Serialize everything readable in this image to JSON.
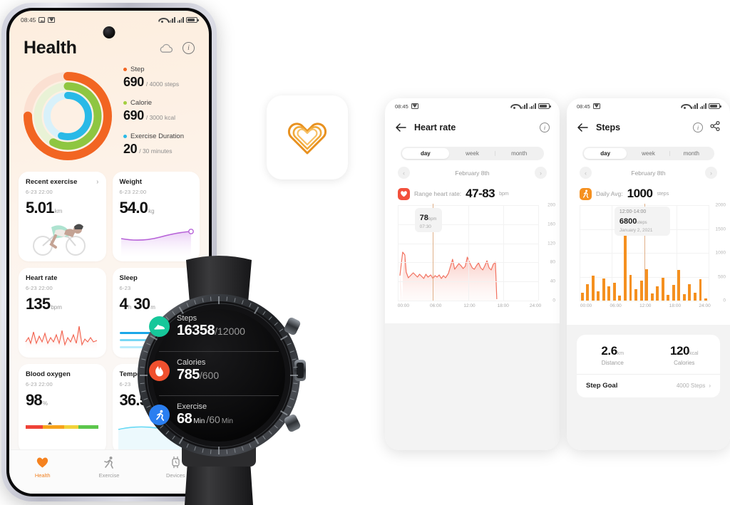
{
  "phone_health": {
    "status": {
      "time": "08:45",
      "icons": [
        "image-icon",
        "mail-icon",
        "wifi-icon",
        "signal-icon",
        "signal-icon",
        "battery-icon"
      ]
    },
    "header": {
      "title": "Health",
      "cloud_icon": "cloud-icon",
      "info_icon": "info-icon"
    },
    "rings": {
      "outer_color": "#f26522",
      "middle_color": "#8ec641",
      "inner_color": "#29b9e7",
      "outer_pct": 75,
      "middle_pct": 58,
      "inner_pct": 55
    },
    "metrics": [
      {
        "label": "Step",
        "value": "690",
        "goal": "/ 4000 steps",
        "color": "#f26522"
      },
      {
        "label": "Calorie",
        "value": "690",
        "goal": "/ 3000 kcal",
        "color": "#a3cf3f"
      },
      {
        "label": "Exercise Duration",
        "value": "20",
        "goal": "/ 30 minutes",
        "color": "#29b9e7"
      }
    ],
    "cards": [
      {
        "title": "Recent exercise",
        "date": "6-23  22:00",
        "value": "5.01",
        "unit": "km",
        "chevron": "›",
        "art": "cyclist-illustration"
      },
      {
        "title": "Weight",
        "date": "6-23  22:00",
        "value": "54.0",
        "unit": "kg",
        "chevron": "",
        "art": "weight-trend-line"
      },
      {
        "title": "Heart rate",
        "date": "6-23  22:00",
        "value": "135",
        "unit": "bpm",
        "chevron": "",
        "art": "heartrate-waveform"
      },
      {
        "title": "Sleep",
        "date": "6-23",
        "value": "4",
        "unit": "h",
        "value2": "30",
        "unit2": "m",
        "chevron": "",
        "art": "sleep-bars"
      },
      {
        "title": "Blood oxygen",
        "date": "6-23  22:00",
        "value": "98",
        "unit": "%",
        "chevron": "",
        "art": "spo2-gauge"
      },
      {
        "title": "Temperature",
        "date": "6-23",
        "value": "36.5",
        "unit": "",
        "chevron": "",
        "art": "temp-line"
      }
    ],
    "tabs": [
      {
        "label": "Health",
        "icon": "heart-icon",
        "active": true
      },
      {
        "label": "Exercise",
        "icon": "runner-icon",
        "active": false
      },
      {
        "label": "Devices",
        "icon": "watch-icon",
        "active": false
      }
    ]
  },
  "app_icon": {
    "name": "health-app-logo",
    "shape": "heart-outline-loop",
    "color": "#e8911f"
  },
  "phone_heartrate": {
    "status": {
      "time": "08:45"
    },
    "nav": {
      "back_icon": "back-arrow-icon",
      "title": "Heart rate",
      "info_icon": "info-icon"
    },
    "segments": [
      {
        "label": "day",
        "active": true
      },
      {
        "label": "week",
        "active": false
      },
      {
        "label": "month",
        "active": false
      }
    ],
    "date": {
      "label": "February 8th",
      "prev_icon": "chevron-left-icon",
      "next_icon": "chevron-right-icon"
    },
    "summary": {
      "icon": "heart-rate-icon",
      "icon_color": "#f2503c",
      "label": "Range heart rate:",
      "value": "47-83",
      "unit": "bpm"
    },
    "tooltip": {
      "value": "78",
      "unit": "bpm",
      "time": "07:30"
    },
    "chart_data": {
      "type": "area",
      "title": "Heart rate",
      "xlabel": "",
      "ylabel": "bpm",
      "ylim": [
        0,
        200
      ],
      "yticks": [
        0,
        40,
        80,
        120,
        160,
        200
      ],
      "xticks": [
        "00:00",
        "06:00",
        "12:00",
        "18:00",
        "24:00"
      ],
      "line_color": "#f2705e",
      "fill_color": "#fbd9d3",
      "grid": true,
      "x": [
        0.4,
        0.8,
        1.2,
        1.6,
        2.0,
        2.4,
        2.8,
        3.2,
        3.6,
        4.0,
        4.4,
        4.8,
        5.2,
        5.6,
        6.0,
        6.4,
        6.8,
        7.2,
        7.6,
        8.0,
        8.4,
        8.8,
        9.2,
        9.6,
        10.0,
        10.4,
        10.8,
        11.2,
        11.6,
        12.0,
        12.4,
        12.8,
        13.2,
        13.6,
        14.0,
        14.4,
        14.8,
        15.2,
        15.6,
        16.0,
        16.4,
        16.8,
        17.2,
        17.6,
        18.0
      ],
      "y": [
        52,
        95,
        60,
        48,
        52,
        58,
        54,
        50,
        56,
        52,
        48,
        54,
        50,
        56,
        52,
        48,
        54,
        50,
        52,
        56,
        52,
        50,
        60,
        72,
        86,
        66,
        72,
        78,
        74,
        68,
        72,
        90,
        78,
        70,
        68,
        74,
        80,
        70,
        66,
        74,
        84,
        70,
        66,
        78,
        82
      ]
    }
  },
  "phone_steps": {
    "status": {
      "time": "08:45"
    },
    "nav": {
      "back_icon": "back-arrow-icon",
      "title": "Steps",
      "info_icon": "info-icon",
      "share_icon": "share-icon"
    },
    "segments": [
      {
        "label": "day",
        "active": true
      },
      {
        "label": "week",
        "active": false
      },
      {
        "label": "month",
        "active": false
      }
    ],
    "date": {
      "label": "February 8th",
      "prev_icon": "chevron-left-icon",
      "next_icon": "chevron-right-icon"
    },
    "summary": {
      "icon": "walking-icon",
      "icon_color": "#f5901f",
      "label": "Daily Avg:",
      "value": "1000",
      "unit": "steps"
    },
    "tooltip": {
      "range": "12:00-14:00",
      "value": "6800",
      "unit": "steps",
      "date": "January 2, 2021"
    },
    "stats": [
      {
        "value": "2.6",
        "unit": "km",
        "label": "Distance"
      },
      {
        "value": "120",
        "unit": "kcal",
        "label": "Calories"
      }
    ],
    "goal": {
      "label": "Step Goal",
      "value": "4000 Steps",
      "chevron": "›"
    },
    "chart_data": {
      "type": "bar",
      "title": "Steps",
      "xlabel": "",
      "ylabel": "steps",
      "ylim": [
        0,
        2000
      ],
      "yticks": [
        0,
        500,
        1000,
        1500,
        2000
      ],
      "xticks": [
        "00:00",
        "06:00",
        "12:00",
        "18:00",
        "24:00"
      ],
      "bar_color": "#f5901f",
      "grid": true,
      "categories": [
        "00:00",
        "01:00",
        "02:00",
        "03:00",
        "04:00",
        "05:00",
        "06:00",
        "07:00",
        "08:00",
        "09:00",
        "10:00",
        "11:00",
        "12:00",
        "13:00",
        "14:00",
        "15:00",
        "16:00",
        "17:00",
        "18:00",
        "19:00",
        "20:00",
        "21:00",
        "22:00",
        "23:00"
      ],
      "values": [
        160,
        340,
        520,
        200,
        460,
        300,
        370,
        110,
        1480,
        540,
        240,
        420,
        660,
        150,
        300,
        480,
        120,
        330,
        640,
        140,
        350,
        165,
        450,
        40
      ]
    }
  },
  "watch": {
    "rows": [
      {
        "label": "Steps",
        "value": "16358",
        "goal": "/12000",
        "icon": "shoe-icon",
        "icon_color": "#16c79a"
      },
      {
        "label": "Calories",
        "value": "785",
        "goal": "/600",
        "icon": "flame-icon",
        "icon_color": "#f0502e"
      },
      {
        "label": "Exercise",
        "value": "68",
        "unit": "Min",
        "goal": "/60",
        "unit2": "Min",
        "icon": "runner-icon",
        "icon_color": "#2a7ef0"
      }
    ]
  }
}
